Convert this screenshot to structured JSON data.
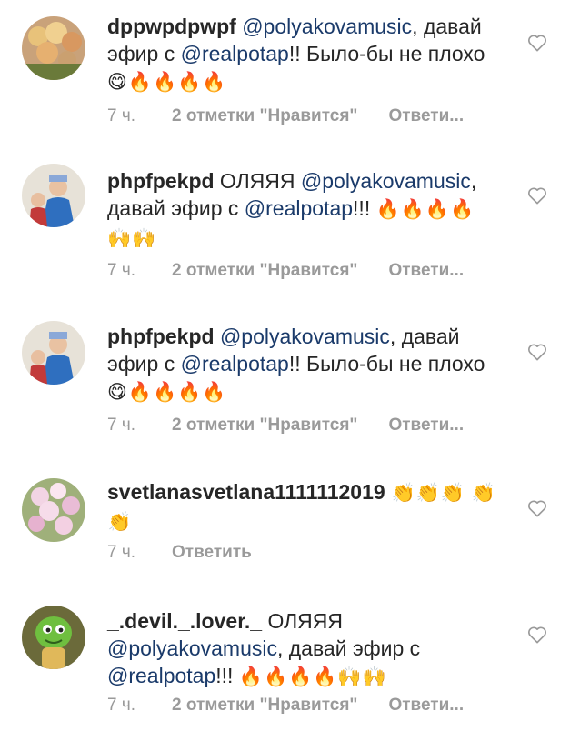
{
  "comments": [
    {
      "username": "dppwpdpwpf",
      "pre": " ",
      "mention1": "@polyakovamusic",
      "mid": ", давай эфир с ",
      "mention2": "@realpotap",
      "post": "!! Было-бы не плохо ",
      "emoji": "😋🔥🔥🔥🔥",
      "time": "7 ч.",
      "likes": "2 отметки \"Нравится\"",
      "reply": "Ответи..."
    },
    {
      "username": "phpfpekpd",
      "pre": " ОЛЯЯЯ ",
      "mention1": "@polyakovamusic",
      "mid": ", давай эфир с ",
      "mention2": "@realpotap",
      "post": "!!! ",
      "emoji": "🔥🔥🔥🔥 🙌🙌",
      "time": "7 ч.",
      "likes": "2 отметки \"Нравится\"",
      "reply": "Ответи..."
    },
    {
      "username": "phpfpekpd",
      "pre": " ",
      "mention1": "@polyakovamusic",
      "mid": ", давай эфир с ",
      "mention2": "@realpotap",
      "post": "!! Было-бы не плохо ",
      "emoji": "😋🔥🔥🔥🔥",
      "time": "7 ч.",
      "likes": "2 отметки \"Нравится\"",
      "reply": "Ответи..."
    },
    {
      "username": "svetlanasvetlana1111112019",
      "emoji": " 👏👏👏 👏👏",
      "time": "7 ч.",
      "reply": "Ответить"
    },
    {
      "username": "_.devil._.lover._",
      "pre": " ОЛЯЯЯ ",
      "mention1": "@polyakovamusic",
      "mid": ", давай эфир с ",
      "mention2": "@realpotap",
      "post": "!!! ",
      "emoji": "🔥🔥🔥🔥🙌🙌",
      "time": "7 ч.",
      "likes": "2 отметки \"Нравится\"",
      "reply": "Ответи..."
    }
  ]
}
